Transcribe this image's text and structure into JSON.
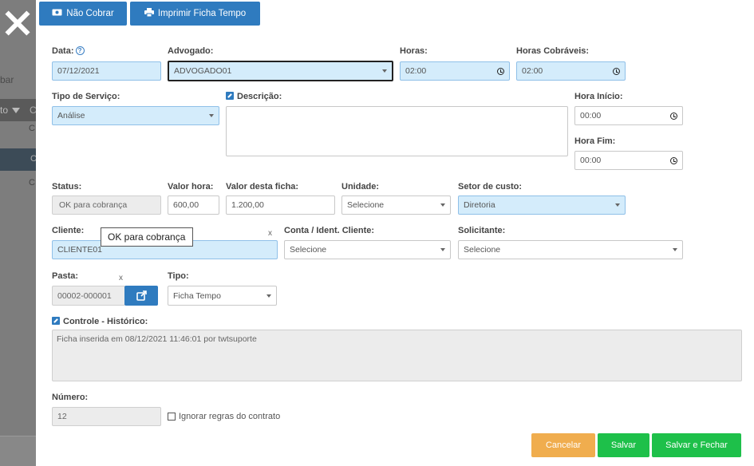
{
  "background": {
    "partial_text": "bar",
    "header_text": "to",
    "row_text_1": "C",
    "row_text_2": "C",
    "row_text_3": "C"
  },
  "toolbar": {
    "nao_cobrar": "Não Cobrar",
    "imprimir": "Imprimir Ficha Tempo"
  },
  "form": {
    "data": {
      "label": "Data:",
      "value": "07/12/2021"
    },
    "advogado": {
      "label": "Advogado:",
      "value": "ADVOGADO01"
    },
    "horas": {
      "label": "Horas:",
      "value": "02:00"
    },
    "horas_cobraveis": {
      "label": "Horas Cobráveis:",
      "value": "02:00"
    },
    "tipo_servico": {
      "label": "Tipo de Serviço:",
      "value": "Análise"
    },
    "descricao": {
      "label": "Descrição:"
    },
    "hora_inicio": {
      "label": "Hora Início:",
      "value": "00:00"
    },
    "hora_fim": {
      "label": "Hora Fim:",
      "value": "00:00"
    },
    "status": {
      "label": "Status:",
      "value": "OK para cobrança"
    },
    "valor_hora": {
      "label": "Valor hora:",
      "value": "600,00"
    },
    "valor_ficha": {
      "label": "Valor desta ficha:",
      "value": "1.200,00"
    },
    "unidade": {
      "label": "Unidade:",
      "value": "Selecione"
    },
    "setor_custo": {
      "label": "Setor de custo:",
      "value": "Diretoria"
    },
    "cliente": {
      "label": "Cliente:",
      "value": "CLIENTE01",
      "clear": "x"
    },
    "conta": {
      "label": "Conta / Ident. Cliente:",
      "value": "Selecione"
    },
    "solicitante": {
      "label": "Solicitante:",
      "value": "Selecione"
    },
    "pasta": {
      "label": "Pasta:",
      "value": "00002-000001",
      "clear": "x"
    },
    "tipo": {
      "label": "Tipo:",
      "value": "Ficha Tempo"
    },
    "controle": {
      "label": "Controle - Histórico:",
      "value": "Ficha inserida em 08/12/2021 11:46:01 por twtsuporte"
    },
    "numero": {
      "label": "Número:",
      "value": "12"
    },
    "ignorar": {
      "label": "Ignorar regras do contrato",
      "checked": false
    }
  },
  "tooltip": {
    "text": "OK para cobrança"
  },
  "footer": {
    "cancelar": "Cancelar",
    "salvar": "Salvar",
    "salvar_fechar": "Salvar e Fechar"
  },
  "colors": {
    "primary": "#2f7bbf",
    "field_blue": "#d4ecfb",
    "cancel": "#f0ad4e",
    "save": "#1ec04a"
  }
}
